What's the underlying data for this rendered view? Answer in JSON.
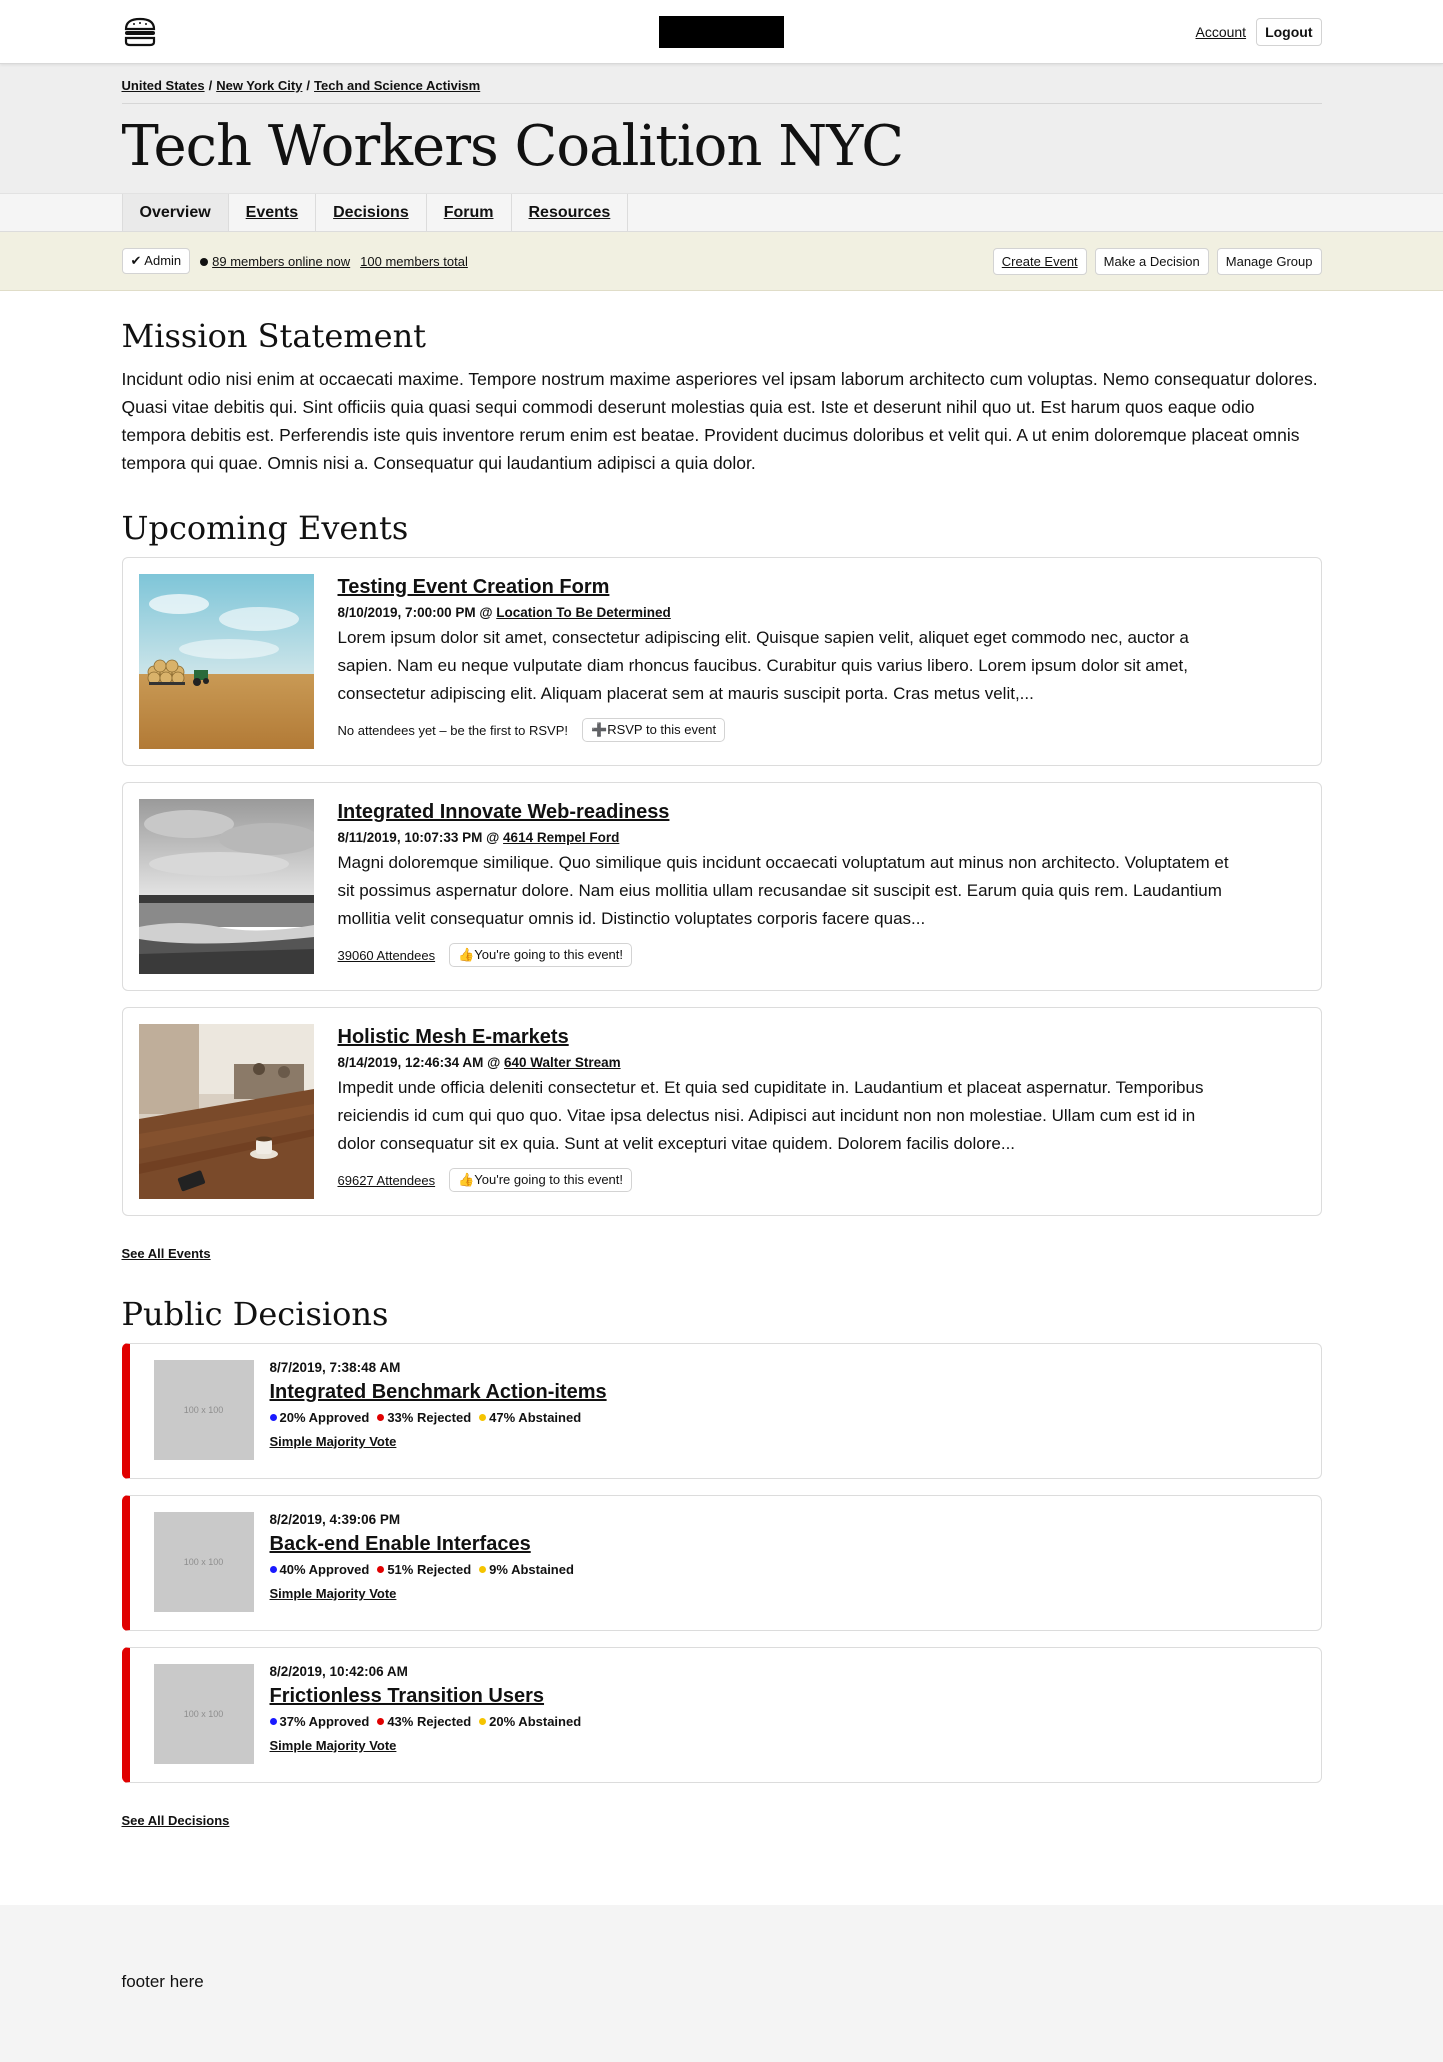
{
  "topbar": {
    "account_label": "Account",
    "logout_label": "Logout"
  },
  "breadcrumb": [
    "United States",
    "New York City",
    "Tech and Science Activism"
  ],
  "group": {
    "title": "Tech Workers Coalition NYC"
  },
  "tabs": [
    "Overview",
    "Events",
    "Decisions",
    "Forum",
    "Resources"
  ],
  "admin": {
    "role_label": "✔ Admin",
    "online_label": "89 members online now",
    "total_label": "100 members total",
    "actions": [
      "Create Event",
      "Make a Decision",
      "Manage Group"
    ]
  },
  "mission": {
    "heading": "Mission Statement",
    "text": "Incidunt odio nisi enim at occaecati maxime. Tempore nostrum maxime asperiores vel ipsam laborum architecto cum voluptas. Nemo consequatur dolores. Quasi vitae debitis qui. Sint officiis quia quasi sequi commodi deserunt molestias quia est. Iste et deserunt nihil quo ut. Est harum quos eaque odio tempora debitis est. Perferendis iste quis inventore rerum enim est beatae. Provident ducimus doloribus et velit qui. A ut enim doloremque placeat omnis tempora qui quae. Omnis nisi a. Consequatur qui laudantium adipisci a quia dolor."
  },
  "events": {
    "heading": "Upcoming Events",
    "see_all": "See All Events",
    "items": [
      {
        "title": "Testing Event Creation Form",
        "datetime": "8/10/2019, 7:00:00 PM @",
        "location": "Location To Be Determined",
        "description": "Lorem ipsum dolor sit amet, consectetur adipiscing elit. Quisque sapien velit, aliquet eget commodo nec, auctor a sapien. Nam eu neque vulputate diam rhoncus faucibus. Curabitur quis varius libero. Lorem ipsum dolor sit amet, consectetur adipiscing elit. Aliquam placerat sem at mauris suscipit porta. Cras metus velit,...",
        "attendees": "No attendees yet – be the first to RSVP!",
        "rsvp": "➕RSVP to this event",
        "image": "farm-field"
      },
      {
        "title": "Integrated Innovate Web-readiness",
        "datetime": "8/11/2019, 10:07:33 PM @",
        "location": "4614 Rempel Ford",
        "description": "Magni doloremque similique. Quo similique quis incidunt occaecati voluptatum aut minus non architecto. Voluptatem et sit possimus aspernatur dolore. Nam eius mollitia ullam recusandae sit suscipit est. Earum quia quis rem. Laudantium mollitia velit consequatur omnis id. Distinctio voluptates corporis facere quas...",
        "attendees": "39060 Attendees",
        "rsvp": "👍You're going to this event!",
        "image": "grey-beach"
      },
      {
        "title": "Holistic Mesh E-markets",
        "datetime": "8/14/2019, 12:46:34 AM @",
        "location": "640 Walter Stream",
        "description": "Impedit unde officia deleniti consectetur et. Et quia sed cupiditate in. Laudantium et placeat aspernatur. Temporibus reiciendis id cum qui quo quo. Vitae ipsa delectus nisi. Adipisci aut incidunt non non molestiae. Ullam cum est id in dolor consequatur sit ex quia. Sunt at velit excepturi vitae quidem. Dolorem facilis dolore...",
        "attendees": "69627 Attendees",
        "rsvp": "👍You're going to this event!",
        "image": "cafe-table"
      }
    ]
  },
  "decisions": {
    "heading": "Public Decisions",
    "see_all": "See All Decisions",
    "thumb_label": "100 x 100",
    "colors": {
      "approved": "#1a1aff",
      "rejected": "#e00000",
      "abstained": "#f5c400",
      "accent": "#e00000"
    },
    "items": [
      {
        "date": "8/7/2019, 7:38:48 AM",
        "title": "Integrated Benchmark Action-items",
        "approved": "20% Approved",
        "rejected": "33% Rejected",
        "abstained": "47% Abstained",
        "vote_type": "Simple Majority Vote"
      },
      {
        "date": "8/2/2019, 4:39:06 PM",
        "title": "Back-end Enable Interfaces",
        "approved": "40% Approved",
        "rejected": "51% Rejected",
        "abstained": "9% Abstained",
        "vote_type": "Simple Majority Vote"
      },
      {
        "date": "8/2/2019, 10:42:06 AM",
        "title": "Frictionless Transition Users",
        "approved": "37% Approved",
        "rejected": "43% Rejected",
        "abstained": "20% Abstained",
        "vote_type": "Simple Majority Vote"
      }
    ]
  },
  "footer": {
    "text": "footer here"
  }
}
